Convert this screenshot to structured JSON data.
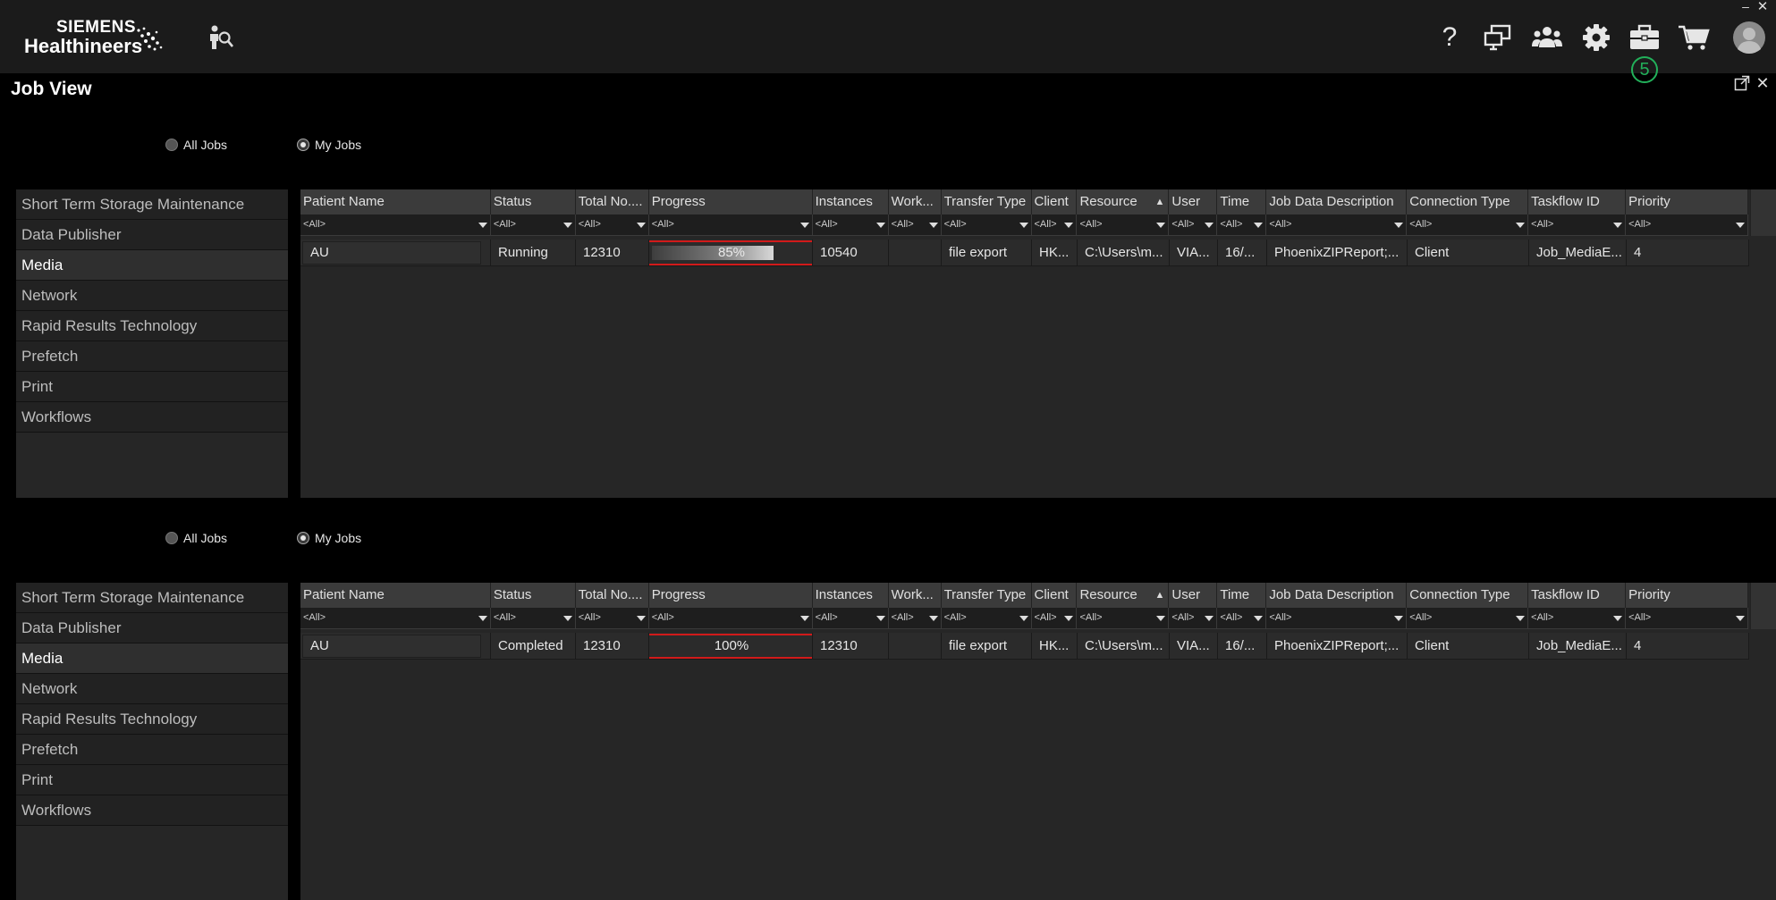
{
  "brand": {
    "line1": "SIEMENS",
    "line2": "Healthineers"
  },
  "topbar": {
    "icons": [
      "find-person-icon",
      "help-icon",
      "monitors-icon",
      "users-group-icon",
      "gear-icon",
      "briefcase-icon",
      "cart-icon",
      "avatar-icon"
    ],
    "help_glyph": "?",
    "briefcase_badge": "5",
    "window_min": "–",
    "window_close": "✕"
  },
  "page": {
    "title": "Job View",
    "close_glyph": "✕"
  },
  "colors": {
    "accent_green": "#22b05a",
    "progress_highlight": "#d11a1a"
  },
  "panels": [
    {
      "radios": {
        "all_jobs": "All Jobs",
        "my_jobs": "My Jobs",
        "selected": "My Jobs"
      },
      "sidebar": [
        "Short Term Storage Maintenance",
        "Data Publisher",
        "Media",
        "Network",
        "Rapid Results Technology",
        "Prefetch",
        "Print",
        "Workflows"
      ],
      "active_item": "Media",
      "columns": [
        "Patient Name",
        "Status",
        "Total No....",
        "Progress",
        "Instances",
        "Work...",
        "Transfer Type",
        "Client",
        "Resource",
        "User",
        "Time",
        "Job Data Description",
        "Connection Type",
        "Taskflow ID",
        "Priority"
      ],
      "filter_value": "<All>",
      "sort_indicator": "▲",
      "row": {
        "patient_name": "AU",
        "status": "Running",
        "total": "12310",
        "progress_label": "85%",
        "progress_value": 0.85,
        "instances": "10540",
        "work": "",
        "transfer_type": "file export",
        "client": "HK...",
        "resource": "C:\\Users\\m...",
        "user": "VIA...",
        "time": "16/...",
        "job_data_description": "PhoenixZIPReport;...",
        "connection_type": "Client",
        "taskflow_id": "Job_MediaE...",
        "priority": "4"
      }
    },
    {
      "radios": {
        "all_jobs": "All Jobs",
        "my_jobs": "My Jobs",
        "selected": "My Jobs"
      },
      "sidebar": [
        "Short Term Storage Maintenance",
        "Data Publisher",
        "Media",
        "Network",
        "Rapid Results Technology",
        "Prefetch",
        "Print",
        "Workflows"
      ],
      "active_item": "Media",
      "columns": [
        "Patient Name",
        "Status",
        "Total No....",
        "Progress",
        "Instances",
        "Work...",
        "Transfer Type",
        "Client",
        "Resource",
        "User",
        "Time",
        "Job Data Description",
        "Connection Type",
        "Taskflow ID",
        "Priority"
      ],
      "filter_value": "<All>",
      "sort_indicator": "▲",
      "row": {
        "patient_name": "AU",
        "status": "Completed",
        "total": "12310",
        "progress_label": "100%",
        "progress_value": 1.0,
        "instances": "12310",
        "work": "",
        "transfer_type": "file export",
        "client": "HK...",
        "resource": "C:\\Users\\m...",
        "user": "VIA...",
        "time": "16/...",
        "job_data_description": "PhoenixZIPReport;...",
        "connection_type": "Client",
        "taskflow_id": "Job_MediaE...",
        "priority": "4"
      }
    }
  ]
}
